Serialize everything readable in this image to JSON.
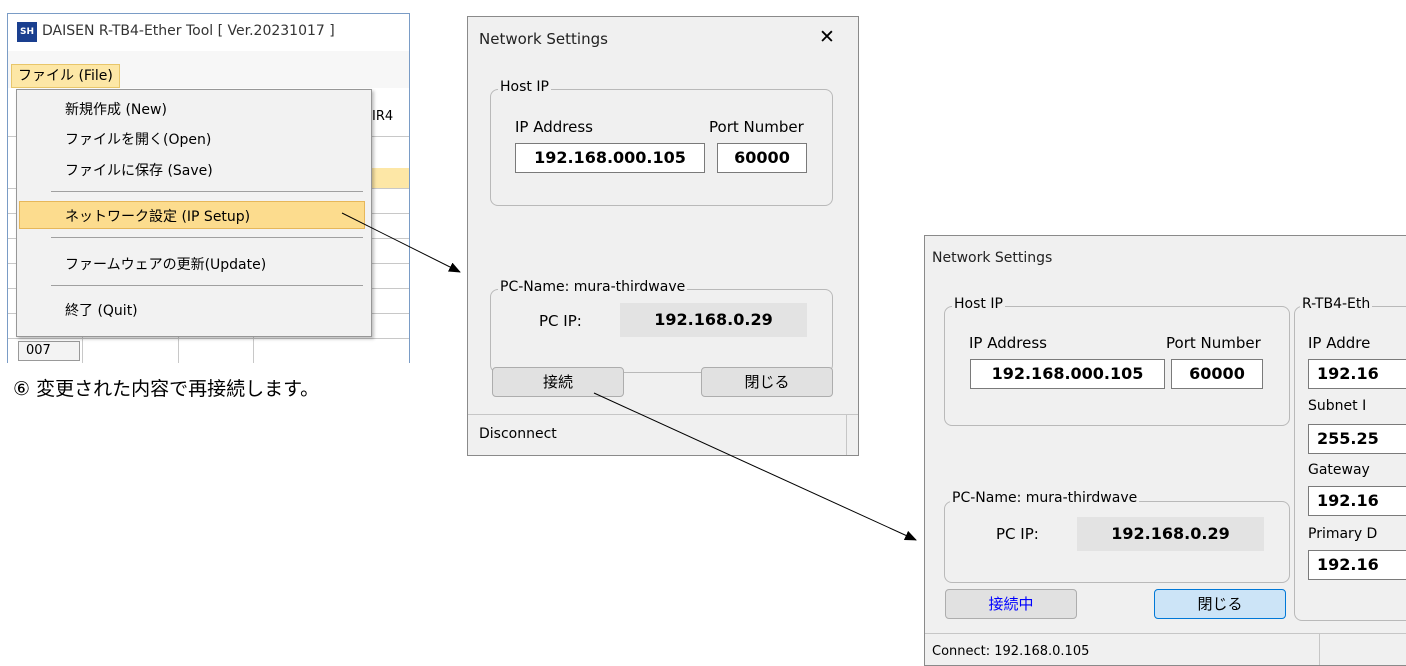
{
  "tool_window": {
    "title": "DAISEN R-TB4-Ether Tool  [ Ver.20231017 ]",
    "menu_file": "ファイル (File)",
    "tab_partial": "IR4",
    "row_label": "007"
  },
  "file_menu": {
    "items": [
      "新規作成 (New)",
      "ファイルを開く(Open)",
      "ファイルに保存 (Save)",
      "ネットワーク設定 (IP Setup)",
      "ファームウェアの更新(Update)",
      "終了 (Quit)"
    ]
  },
  "dialog1": {
    "title": "Network Settings",
    "close": "✕",
    "host_group": "Host IP",
    "ip_label": "IP Address",
    "port_label": "Port Number",
    "ip_value": "192.168.000.105",
    "port_value": "60000",
    "pc_group": "PC-Name: mura-thirdwave",
    "pc_ip_label": "PC IP:",
    "pc_ip_value": "192.168.0.29",
    "connect_button": "接続",
    "close_button": "閉じる",
    "status": "Disconnect"
  },
  "dialog2": {
    "title": "Network Settings",
    "host_group": "Host IP",
    "ip_label": "IP Address",
    "port_label": "Port Number",
    "ip_value": "192.168.000.105",
    "port_value": "60000",
    "pc_group": "PC-Name: mura-thirdwave",
    "pc_ip_label": "PC IP:",
    "pc_ip_value": "192.168.0.29",
    "connect_button": "接続中",
    "close_button": "閉じる",
    "status": "Connect: 192.168.0.105",
    "rtb4_group": "R-TB4-Eth",
    "rtb4_ip_label": "IP Addre",
    "rtb4_ip_value": "192.16",
    "subnet_label": "Subnet I",
    "subnet_value": "255.25",
    "gateway_label": "Gateway",
    "gateway_value": "192.16",
    "primary_label": "Primary D",
    "primary_value": "192.16"
  },
  "caption": "⑥ 変更された内容で再接続します。",
  "colors": {
    "menu_highlight": "#fcdc8e",
    "connecting_text": "#0000ff",
    "close_button_active": "#cce4f7"
  }
}
